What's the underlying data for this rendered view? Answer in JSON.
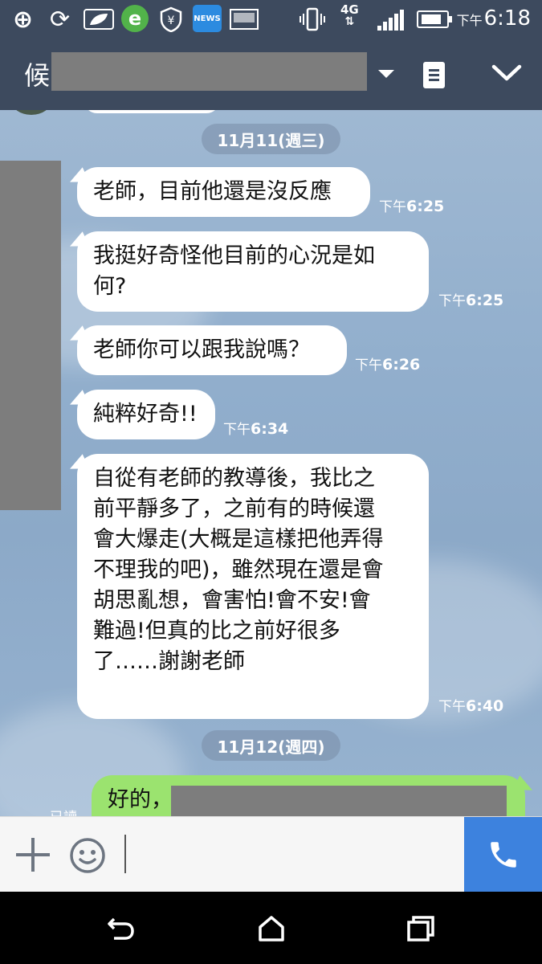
{
  "status_bar": {
    "news_label": "NEWS",
    "network_label": "4G",
    "time_ampm": "下午",
    "time": "6:18"
  },
  "header": {
    "contact_name": "候"
  },
  "chat": {
    "date_1": "11月11(週三)",
    "date_2": "11月12(週四)",
    "messages": [
      {
        "text": "老師，目前他還是沒反應",
        "ampm": "下午",
        "time": "6:25"
      },
      {
        "text": "我挺好奇怪他目前的心況是如\n何?",
        "ampm": "下午",
        "time": "6:25"
      },
      {
        "text": "老師你可以跟我說嗎？",
        "ampm": "下午",
        "time": "6:26"
      },
      {
        "text": "純粹好奇!!",
        "ampm": "下午",
        "time": "6:34"
      },
      {
        "text": "自從有老師的教導後，我比之\n前平靜多了，之前有的時候還\n會大爆走(大概是這樣把他弄得\n不理我的吧)，雖然現在還是會\n胡思亂想，會害怕!會不安!會\n難過!但真的比之前好很多\n了……謝謝老師",
        "ampm": "下午",
        "time": "6:40"
      }
    ],
    "my_message": "好的，",
    "read_label": "已讀"
  },
  "input": {
    "placeholder": ""
  },
  "colors": {
    "header_bg": "#3d4a5e",
    "my_bubble": "#9be36f",
    "call_button": "#3d82de"
  },
  "icons": [
    "add-icon",
    "sync-icon",
    "leaf-icon",
    "browser-e-icon",
    "shield-icon",
    "news-icon",
    "image-icon",
    "vibrate-icon",
    "signal-icon",
    "battery-icon",
    "chevron-down-icon",
    "note-icon",
    "plus-icon",
    "emoji-icon",
    "phone-icon",
    "back-icon",
    "home-icon",
    "recents-icon"
  ]
}
